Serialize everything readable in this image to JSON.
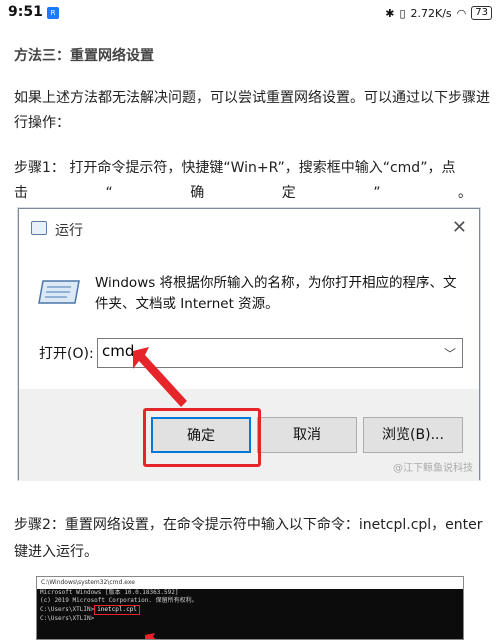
{
  "status_bar": {
    "time": "9:51",
    "badge": "R",
    "speed": "2.72K/s",
    "battery": "73"
  },
  "article": {
    "method_heading": "方法三：重置网络设置",
    "intro": "如果上述方法都无法解决问题，可以尝试重置网络设置。可以通过以下步骤进行操作：",
    "step1_line1": "步骤1： 打开命令提示符，快捷键“Win+R”，搜索框中输入“cmd”，点",
    "step1_line2": [
      "击",
      "“",
      "确",
      "定",
      "”",
      "。"
    ],
    "step2": "步骤2：重置网络设置，在命令提示符中输入以下命令：inetcpl.cpl，enter键进入运行。"
  },
  "run_dialog": {
    "title": "运行",
    "close": "✕",
    "description": "Windows 将根据你所输入的名称，为你打开相应的程序、文件夹、文档或 Internet 资源。",
    "open_label": "打开(O):",
    "input_value": "cmd",
    "ok_label": "确定",
    "cancel_label": "取消",
    "browse_label": "浏览(B)...",
    "watermark": "@江下鲸鱼说科技"
  },
  "cmd_window": {
    "title": "C:\\Windows\\system32\\cmd.exe",
    "lines": [
      "Microsoft Windows [版本 10.0.18363.592]",
      "(c) 2019 Microsoft Corporation. 保留所有权利。",
      "",
      "C:\\Users\\XTLIN>",
      "C:\\Users\\XTLIN>"
    ],
    "command": "inetcpl.cpl"
  },
  "colors": {
    "highlight_red": "#e5252a",
    "ok_border": "#0078d7"
  }
}
